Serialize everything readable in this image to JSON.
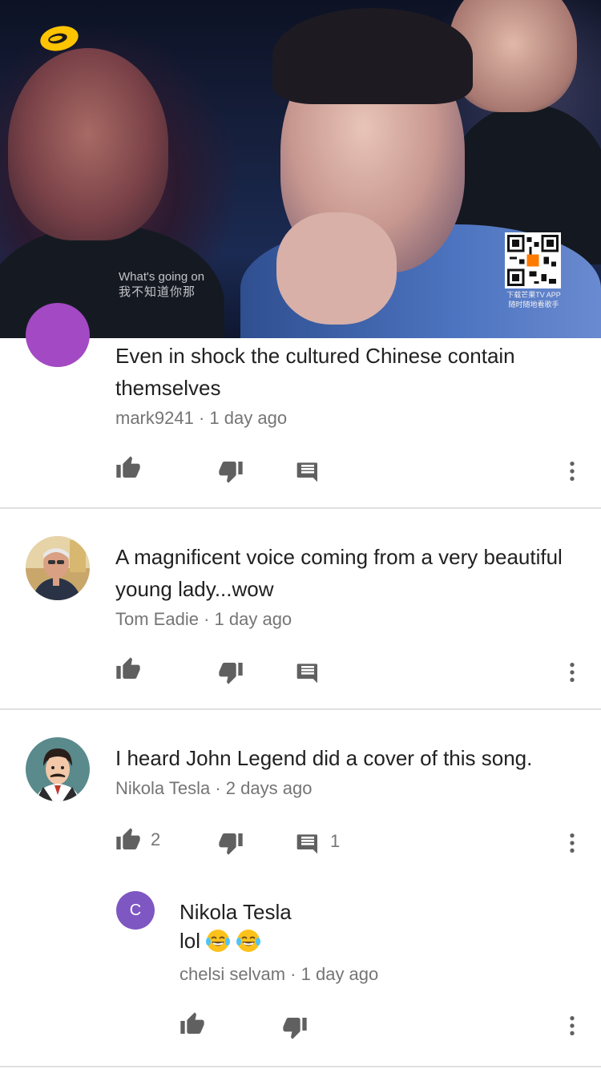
{
  "video": {
    "caption_en": "What's going on",
    "caption_cn": "我不知道你那",
    "qr_caption_1": "下载芒果TV APP",
    "qr_caption_2": "随时随地看歌手"
  },
  "comments": [
    {
      "text": "Even in shock the cultured Chinese contain themselves",
      "author": "mark9241",
      "time": "1 day ago",
      "likes": "",
      "replies": ""
    },
    {
      "text": "A magnificent voice coming from a very beautiful young lady...wow",
      "author": "Tom Eadie",
      "time": "1 day ago",
      "likes": "",
      "replies": ""
    },
    {
      "text": "I heard John Legend did a cover of this song.",
      "author": "Nikola Tesla",
      "time": "2 days ago",
      "likes": "2",
      "replies": "1"
    }
  ],
  "reply": {
    "avatar_letter": "C",
    "mention": "Nikola Tesla",
    "text": "lol",
    "author": "chelsi selvam",
    "time": "1 day ago"
  },
  "separator": "·",
  "colors": {
    "purple_avatar": "#a349c3",
    "reply_avatar": "#7e57c2",
    "meta_gray": "#757575",
    "icon_gray": "#606060"
  },
  "icons": [
    "like-icon",
    "dislike-icon",
    "reply-icon",
    "more-vert-icon"
  ]
}
